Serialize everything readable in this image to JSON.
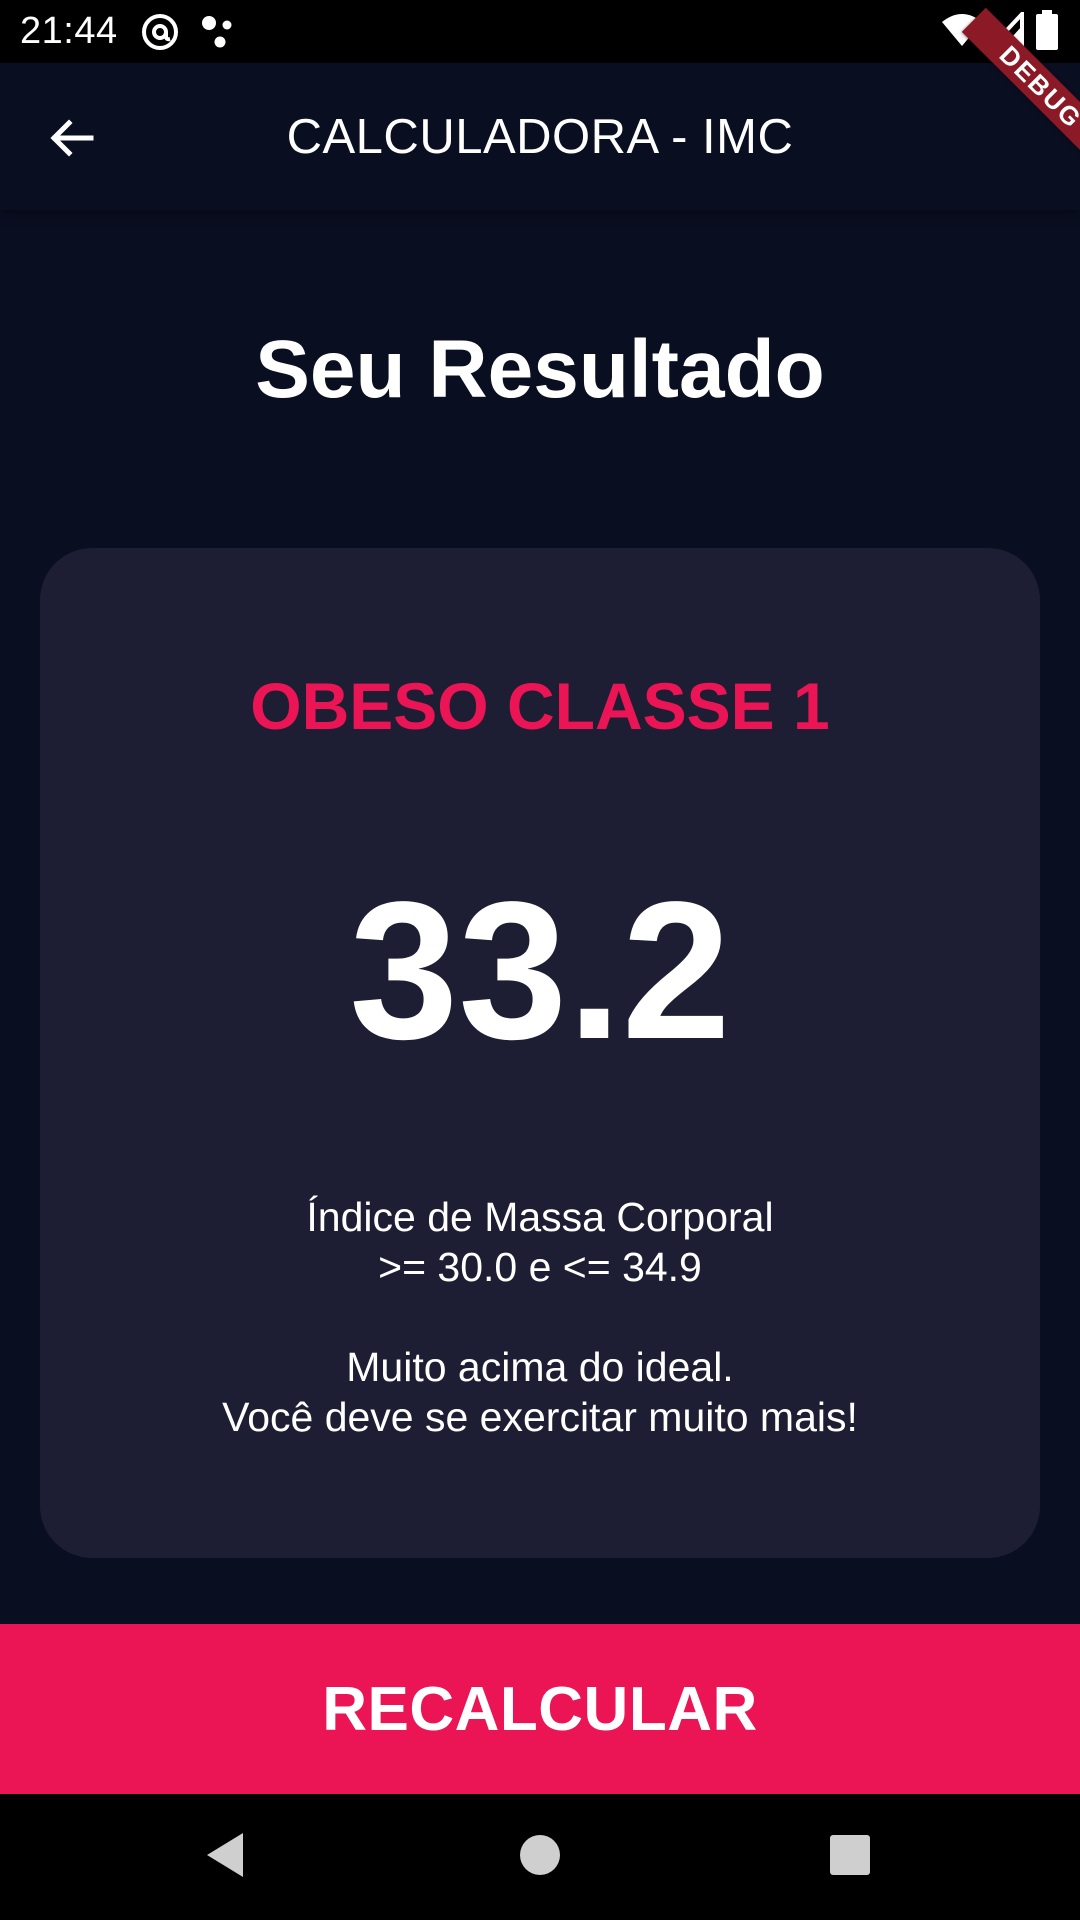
{
  "status_bar": {
    "time": "21:44",
    "icons": [
      "at-sign-icon",
      "dots-icon",
      "wifi-icon",
      "signal-icon",
      "battery-icon"
    ]
  },
  "app_bar": {
    "title": "CALCULADORA - IMC",
    "back_icon": "arrow-back-icon",
    "debug_banner": "DEBUG"
  },
  "page": {
    "title": "Seu Resultado"
  },
  "result": {
    "category": "OBESO CLASSE 1",
    "value": "33.2",
    "range_line1": "Índice de Massa Corporal",
    "range_line2": ">= 30.0 e <= 34.9",
    "advice_line1": "Muito acima do ideal.",
    "advice_line2": "Você deve se exercitar muito mais!"
  },
  "button": {
    "label": "RECALCULAR"
  },
  "colors": {
    "background": "#0a0e21",
    "card": "#1d1e33",
    "accent": "#eb1555",
    "text": "#ffffff"
  },
  "nav_bar": {
    "icons": [
      "back-triangle-icon",
      "home-circle-icon",
      "recents-square-icon"
    ]
  }
}
